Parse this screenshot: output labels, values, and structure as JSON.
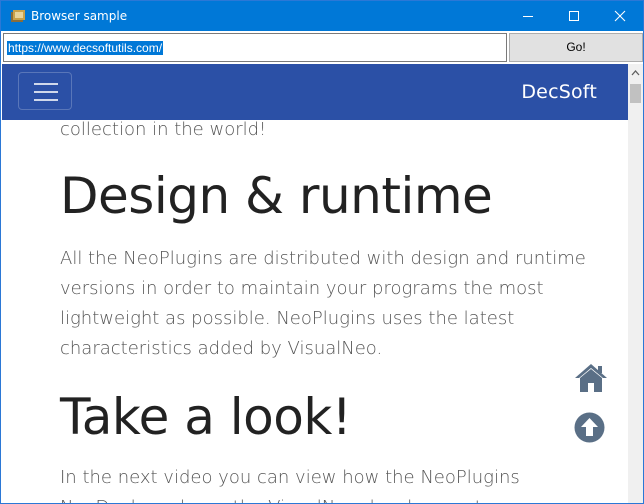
{
  "window": {
    "title": "Browser sample"
  },
  "address_bar": {
    "url": "https://www.decsoftutils.com/",
    "go_label": "Go!"
  },
  "site": {
    "brand": "DecSoft",
    "intro_tail": "collection in the world!",
    "section1": {
      "heading": "Design & runtime",
      "lines": [
        "All the NeoPlugins are distributed with design and runtime",
        "versions in order to maintain your programs the most",
        "lightweight as possible. NeoPlugins uses the latest",
        "characteristics added by VisualNeo."
      ]
    },
    "section2": {
      "heading": "Take a look!",
      "lines": [
        "In the next video you can view how the NeoPlugins",
        "NeoDesk   works on the VisualNeo development"
      ]
    }
  },
  "colors": {
    "titlebar": "#0078d7",
    "navbar": "#2b50a6",
    "fab": "#5a6f86"
  },
  "icons": [
    "app-icon",
    "minimize-icon",
    "maximize-icon",
    "close-icon",
    "menu-icon",
    "home-icon",
    "arrow-up-icon",
    "scroll-up-arrow-icon"
  ]
}
